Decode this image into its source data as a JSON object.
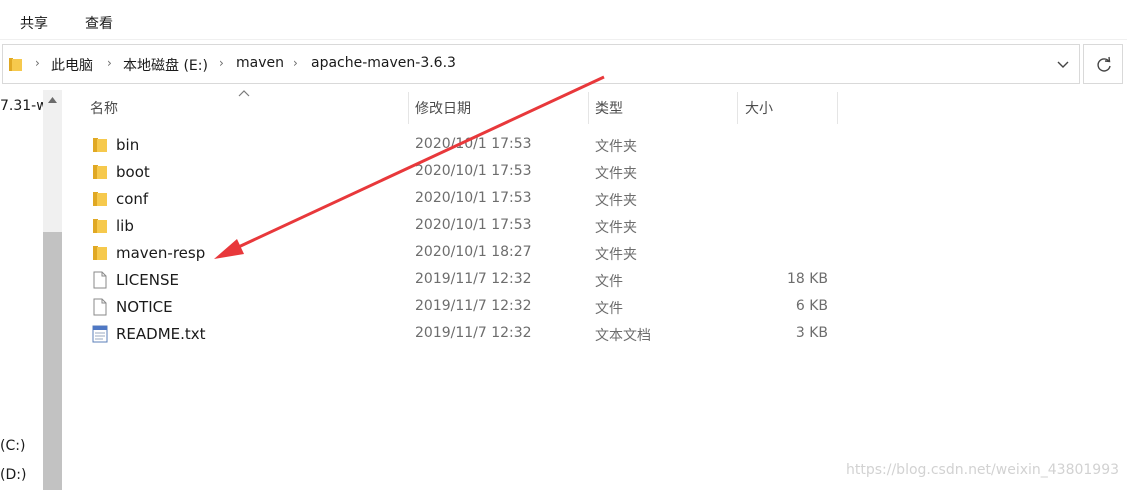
{
  "ribbon": {
    "tabs": [
      "共享",
      "查看"
    ]
  },
  "address": {
    "crumbs": [
      "此电脑",
      "本地磁盘 (E:)",
      "maven",
      "apache-maven-3.6.3"
    ],
    "separator": "›"
  },
  "nav": {
    "items": [
      "7.31-w",
      "(C:)",
      "(D:)"
    ]
  },
  "columns": {
    "name": "名称",
    "date": "修改日期",
    "type": "类型",
    "size": "大小"
  },
  "files": [
    {
      "name": "bin",
      "date": "2020/10/1 17:53",
      "type": "文件夹",
      "size": "",
      "icon": "folder-icon"
    },
    {
      "name": "boot",
      "date": "2020/10/1 17:53",
      "type": "文件夹",
      "size": "",
      "icon": "folder-icon"
    },
    {
      "name": "conf",
      "date": "2020/10/1 17:53",
      "type": "文件夹",
      "size": "",
      "icon": "folder-icon"
    },
    {
      "name": "lib",
      "date": "2020/10/1 17:53",
      "type": "文件夹",
      "size": "",
      "icon": "folder-icon"
    },
    {
      "name": "maven-resp",
      "date": "2020/10/1 18:27",
      "type": "文件夹",
      "size": "",
      "icon": "folder-icon"
    },
    {
      "name": "LICENSE",
      "date": "2019/11/7 12:32",
      "type": "文件",
      "size": "18 KB",
      "icon": "file-icon"
    },
    {
      "name": "NOTICE",
      "date": "2019/11/7 12:32",
      "type": "文件",
      "size": "6 KB",
      "icon": "file-icon"
    },
    {
      "name": "README.txt",
      "date": "2019/11/7 12:32",
      "type": "文本文档",
      "size": "3 KB",
      "icon": "text-document-icon"
    }
  ],
  "watermark": "https://blog.csdn.net/weixin_43801993",
  "colors": {
    "annotation_arrow": "#e8383b",
    "folder": "#f6c94d"
  }
}
